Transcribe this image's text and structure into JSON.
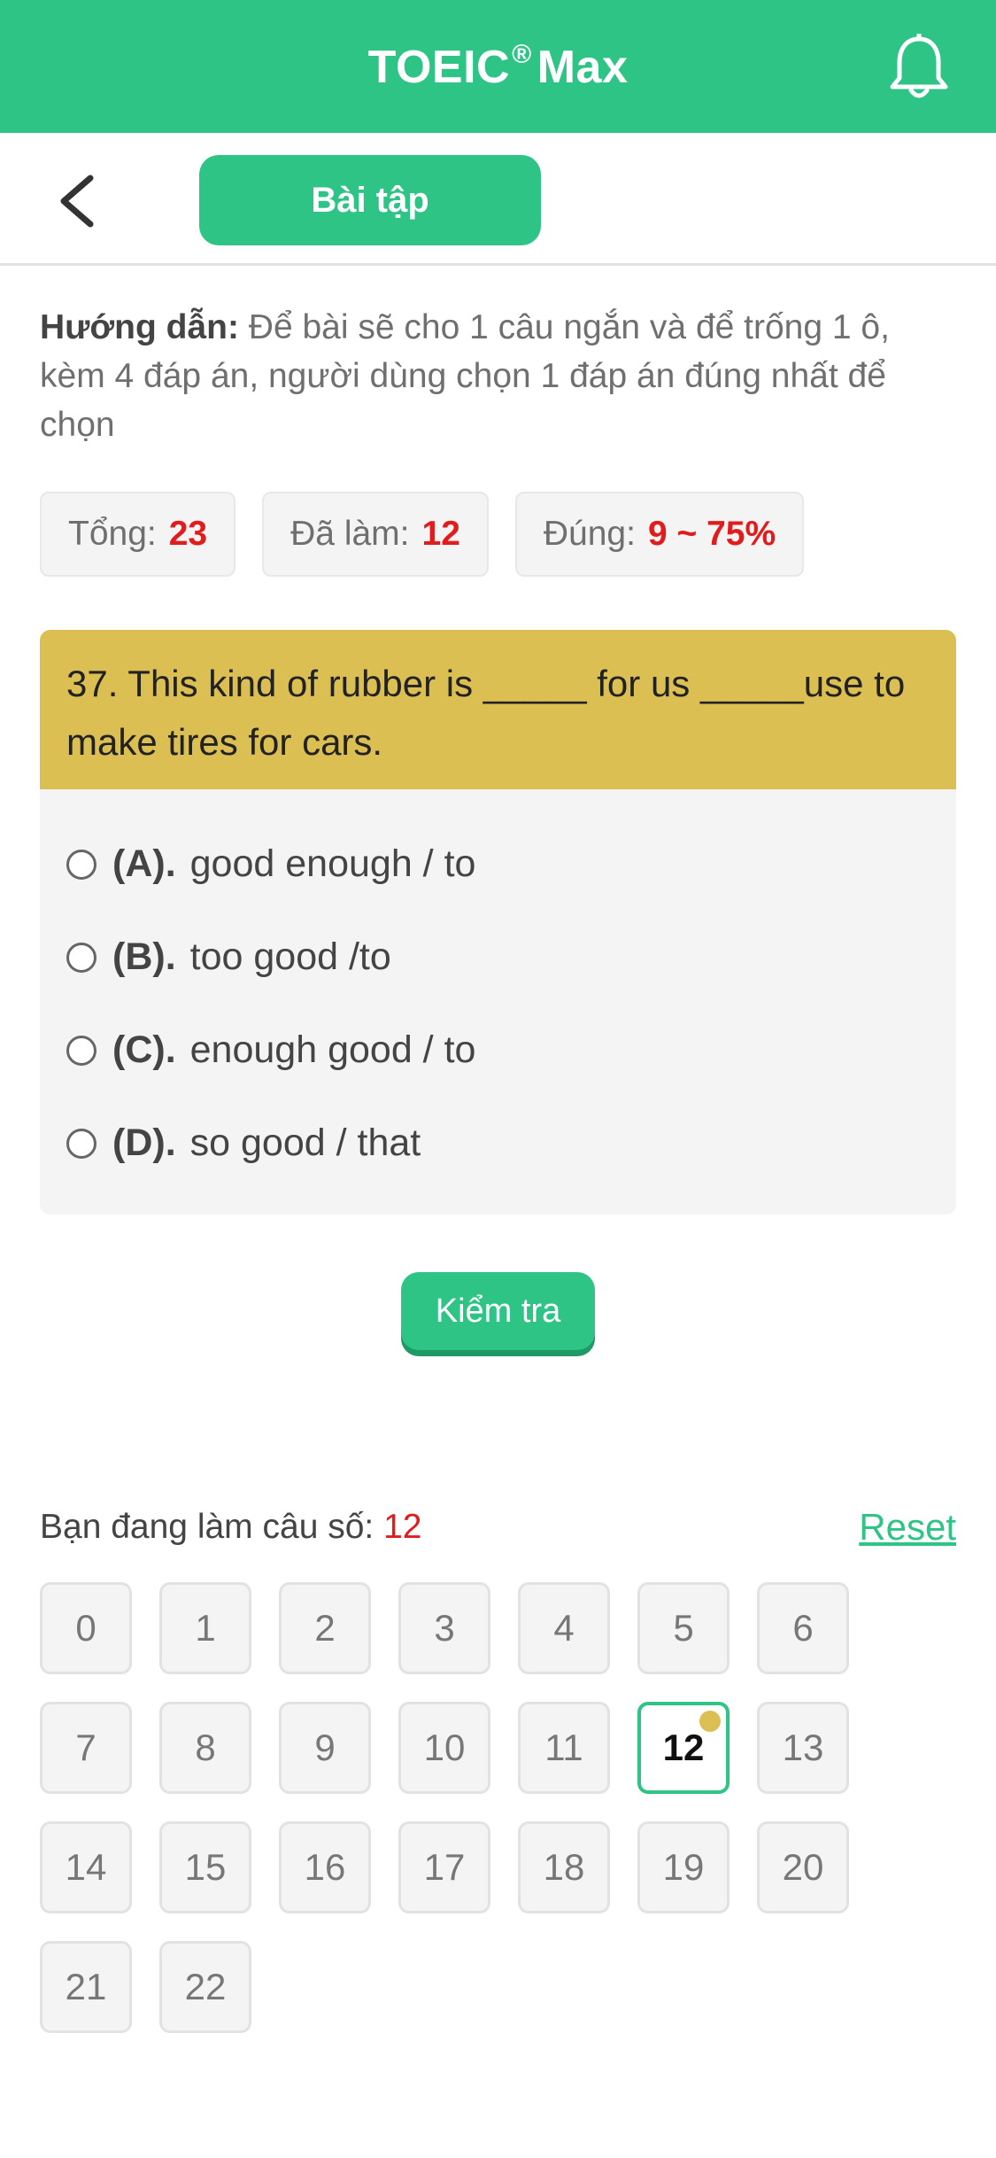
{
  "header": {
    "title_main": "TOEIC",
    "title_reg": "®",
    "title_rest": "Max"
  },
  "nav": {
    "tab_label": "Bài tập"
  },
  "instructions": {
    "label": "Hướng dẫn:",
    "text": "Để bài sẽ cho 1 câu ngắn và để trống 1 ô, kèm 4 đáp án, người dùng chọn 1 đáp án đúng nhất để chọn"
  },
  "stats": {
    "total_label": "Tổng:",
    "total_value": "23",
    "done_label": "Đã làm:",
    "done_value": "12",
    "correct_label": "Đúng:",
    "correct_value": "9 ~ 75%"
  },
  "question": {
    "text": "37. This kind of rubber is _____ for us _____use to make tires for cars.",
    "options": [
      {
        "label": "(A).",
        "text": "good enough / to"
      },
      {
        "label": "(B).",
        "text": "too good /to"
      },
      {
        "label": "(C).",
        "text": "enough good / to"
      },
      {
        "label": "(D).",
        "text": "so good / that"
      }
    ]
  },
  "actions": {
    "check_label": "Kiểm tra"
  },
  "progress": {
    "label": "Bạn đang làm câu số:",
    "current": "12",
    "reset_label": "Reset"
  },
  "grid": {
    "cells": [
      "0",
      "1",
      "2",
      "3",
      "4",
      "5",
      "6",
      "7",
      "8",
      "9",
      "10",
      "11",
      "12",
      "13",
      "14",
      "15",
      "16",
      "17",
      "18",
      "19",
      "20",
      "21",
      "22"
    ],
    "active_index": 12
  },
  "colors": {
    "brand": "#2ec486",
    "question_header": "#dcbf52",
    "highlight": "#e01c1c"
  }
}
